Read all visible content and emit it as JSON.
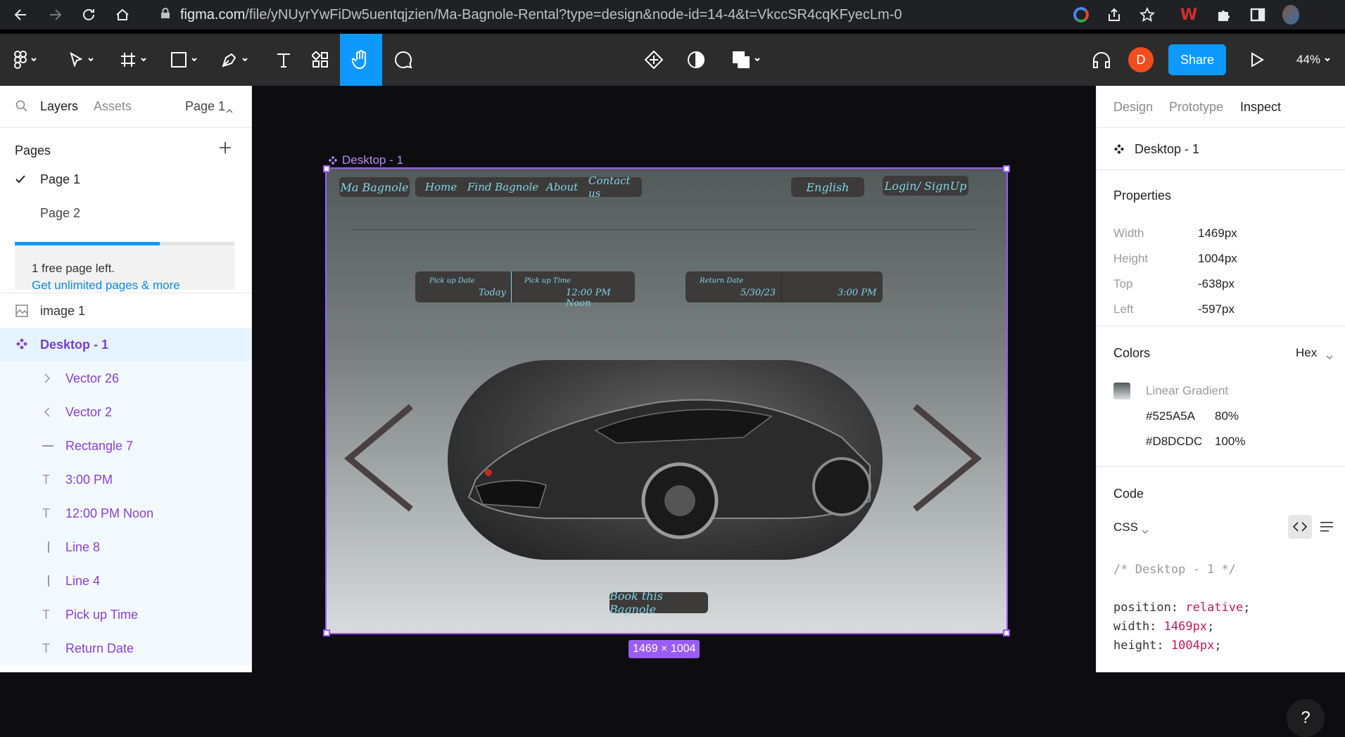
{
  "browser": {
    "url_host": "figma.com",
    "url_path": "/file/yNUyrYwFiDw5uentqjzien/Ma-Bagnole-Rental?type=design&node-id=14-4&t=VkccSR4cqKFyecLm-0"
  },
  "toolbar": {
    "avatar_initial": "D",
    "share_label": "Share",
    "zoom": "44%"
  },
  "left_panel": {
    "tabs": {
      "layers": "Layers",
      "assets": "Assets",
      "page_selector": "Page 1"
    },
    "pages_heading": "Pages",
    "pages": [
      {
        "label": "Page 1"
      },
      {
        "label": "Page 2"
      }
    ],
    "upsell_text": "1 free page left.",
    "upsell_link": "Get unlimited pages & more",
    "upsell_progress": 0.66,
    "layers": [
      {
        "label": "image 1"
      },
      {
        "label": "Desktop - 1"
      },
      {
        "label": "Vector 26"
      },
      {
        "label": "Vector 2"
      },
      {
        "label": "Rectangle 7"
      },
      {
        "label": "3:00 PM"
      },
      {
        "label": "12:00 PM Noon"
      },
      {
        "label": "Line 8"
      },
      {
        "label": "Line 4"
      },
      {
        "label": "Pick up Time"
      },
      {
        "label": "Return Date"
      }
    ]
  },
  "canvas": {
    "frame_label": "Desktop - 1",
    "size_badge": "1469 × 1004",
    "design": {
      "logo": "Ma Bagnole",
      "nav": [
        "Home",
        "Find Bagnole",
        "About",
        "Contact us"
      ],
      "language": "English",
      "login": "Login/ SignUp",
      "pickup_date_label": "Pick up Date",
      "pickup_date_value": "Today",
      "pickup_time_label": "Pick up Time",
      "pickup_time_value": "12:00 PM Noon",
      "return_date_label": "Return Date",
      "return_date_value": "5/30/23",
      "return_time_value": "3:00 PM",
      "book_button": "Book  this Bagnole"
    }
  },
  "right_panel": {
    "tabs": {
      "design": "Design",
      "prototype": "Prototype",
      "inspect": "Inspect"
    },
    "selection": "Desktop - 1",
    "properties_heading": "Properties",
    "properties": [
      {
        "label": "Width",
        "value": "1469px"
      },
      {
        "label": "Height",
        "value": "1004px"
      },
      {
        "label": "Top",
        "value": "-638px"
      },
      {
        "label": "Left",
        "value": "-597px"
      }
    ],
    "colors_heading": "Colors",
    "color_format": "Hex",
    "gradient_label": "Linear Gradient",
    "gradient_stops": [
      {
        "hex": "#525A5A",
        "opacity": "80%"
      },
      {
        "hex": "#D8DCDC",
        "opacity": "100%"
      }
    ],
    "code_heading": "Code",
    "code_lang": "CSS",
    "code_comment": "/* Desktop - 1 */",
    "code_lines": [
      {
        "prop": "position: ",
        "val": "relative",
        "end": ";"
      },
      {
        "prop": "width: ",
        "val": "1469px",
        "end": ";"
      },
      {
        "prop": "height: ",
        "val": "1004px",
        "end": ";"
      }
    ]
  },
  "colors": {
    "accent_purple": "#9b5cf6",
    "share_blue": "#0d99ff",
    "avatar_orange": "#f24e1e",
    "design_text_cyan": "#7fd6e8"
  }
}
